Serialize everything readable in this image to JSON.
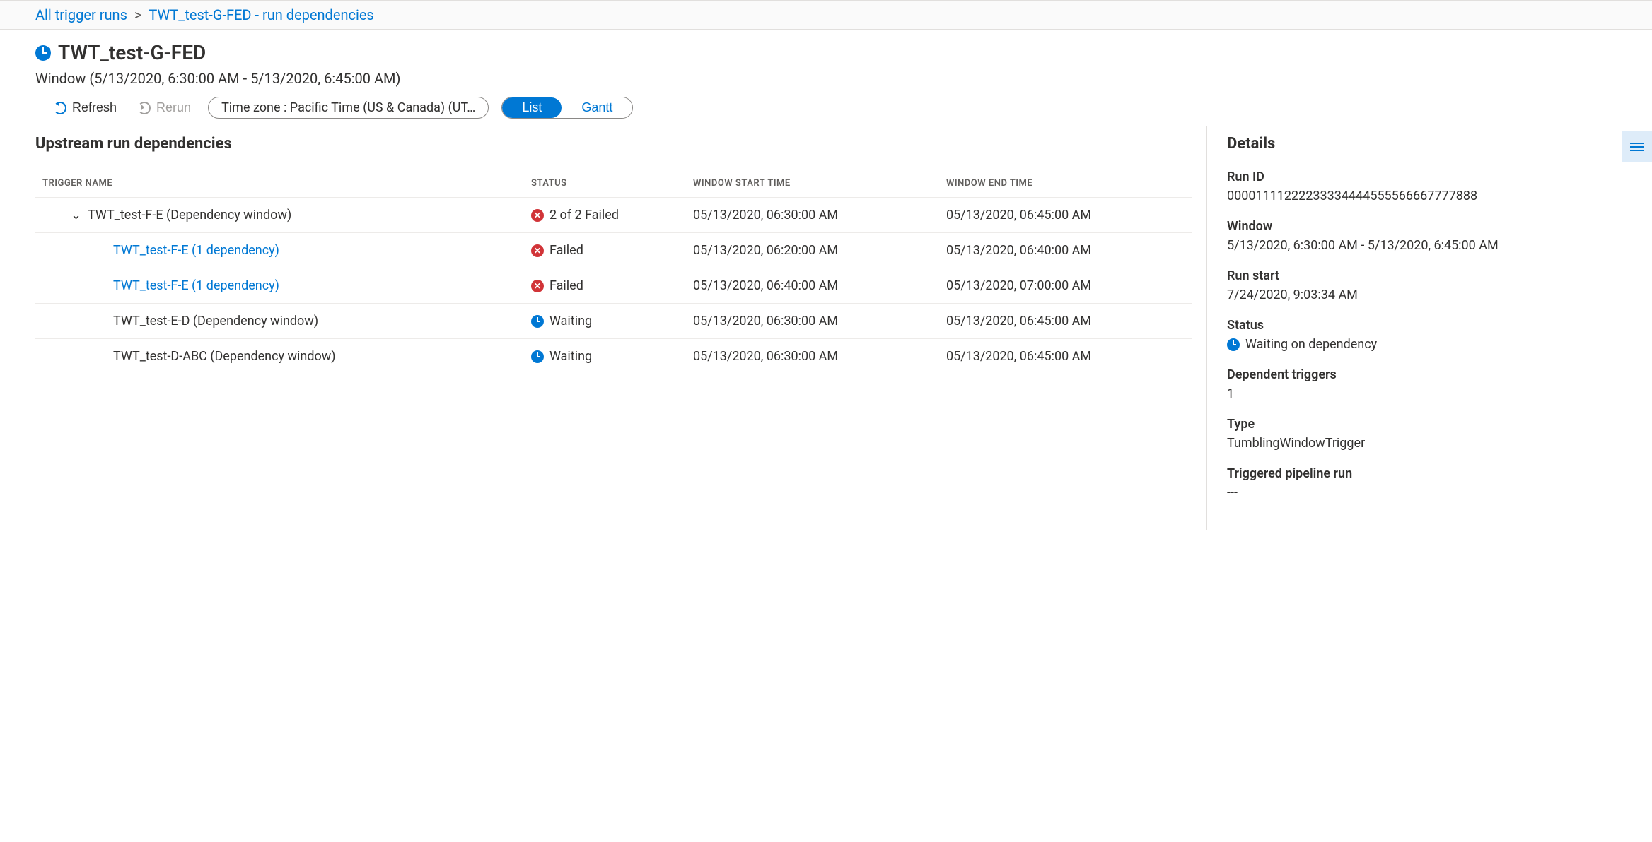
{
  "breadcrumb": {
    "root": "All trigger runs",
    "current": "TWT_test-G-FED - run dependencies"
  },
  "header": {
    "title": "TWT_test-G-FED",
    "window_label": "Window (5/13/2020, 6:30:00 AM - 5/13/2020, 6:45:00 AM)"
  },
  "toolbar": {
    "refresh": "Refresh",
    "rerun": "Rerun",
    "timezone": "Time zone : Pacific Time (US & Canada) (UT…",
    "list": "List",
    "gantt": "Gantt"
  },
  "left": {
    "section_title": "Upstream run dependencies",
    "columns": {
      "name": "TRIGGER NAME",
      "status": "STATUS",
      "start": "WINDOW START TIME",
      "end": "WINDOW END TIME"
    },
    "rows": [
      {
        "indent": 1,
        "expandable": true,
        "name": "TWT_test-F-E (Dependency window)",
        "link": false,
        "status_icon": "fail",
        "status_text": "2 of 2 Failed",
        "start": "05/13/2020, 06:30:00 AM",
        "end": "05/13/2020, 06:45:00 AM"
      },
      {
        "indent": 2,
        "expandable": false,
        "name": "TWT_test-F-E (1 dependency)",
        "link": true,
        "status_icon": "fail",
        "status_text": "Failed",
        "start": "05/13/2020, 06:20:00 AM",
        "end": "05/13/2020, 06:40:00 AM"
      },
      {
        "indent": 2,
        "expandable": false,
        "name": "TWT_test-F-E (1 dependency)",
        "link": true,
        "status_icon": "fail",
        "status_text": "Failed",
        "start": "05/13/2020, 06:40:00 AM",
        "end": "05/13/2020, 07:00:00 AM"
      },
      {
        "indent": 2,
        "expandable": false,
        "name": "TWT_test-E-D (Dependency window)",
        "link": false,
        "status_icon": "wait",
        "status_text": "Waiting",
        "start": "05/13/2020, 06:30:00 AM",
        "end": "05/13/2020, 06:45:00 AM"
      },
      {
        "indent": 2,
        "expandable": false,
        "name": "TWT_test-D-ABC (Dependency window)",
        "link": false,
        "status_icon": "wait",
        "status_text": "Waiting",
        "start": "05/13/2020, 06:30:00 AM",
        "end": "05/13/2020, 06:45:00 AM"
      }
    ]
  },
  "details": {
    "title": "Details",
    "run_id_label": "Run ID",
    "run_id": "00001111222233334444555566667777888",
    "window_label": "Window",
    "window": "5/13/2020, 6:30:00 AM - 5/13/2020, 6:45:00 AM",
    "run_start_label": "Run start",
    "run_start": "7/24/2020, 9:03:34 AM",
    "status_label": "Status",
    "status": "Waiting on dependency",
    "dep_triggers_label": "Dependent triggers",
    "dep_triggers": "1",
    "type_label": "Type",
    "type": "TumblingWindowTrigger",
    "pipeline_label": "Triggered pipeline run",
    "pipeline": "---"
  }
}
